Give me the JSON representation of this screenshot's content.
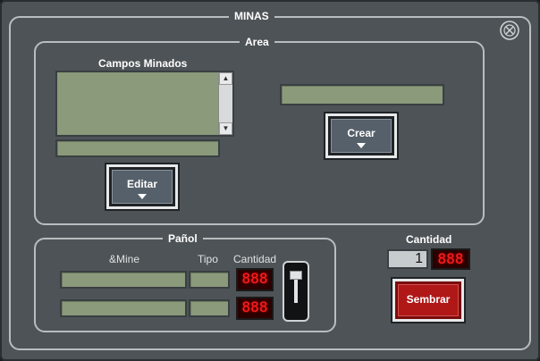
{
  "window": {
    "title": "MINAS"
  },
  "area": {
    "label": "Area",
    "campos_label": "Campos Minados",
    "crear_label": "Crear",
    "editar_label": "Editar"
  },
  "panol": {
    "label": "Pañol",
    "col_mine": "&Mine",
    "col_tipo": "Tipo",
    "col_cantidad": "Cantidad",
    "rows": [
      {
        "led_value": "888"
      },
      {
        "led_value": "888"
      }
    ]
  },
  "cantidad": {
    "label": "Cantidad",
    "value": "1",
    "led_value": "888"
  },
  "sembrar_label": "Sembrar",
  "icons": {
    "close": "close-icon",
    "scroll_up": "arrow-up-icon",
    "scroll_down": "arrow-down-icon",
    "chevron": "chevron-down-icon"
  }
}
